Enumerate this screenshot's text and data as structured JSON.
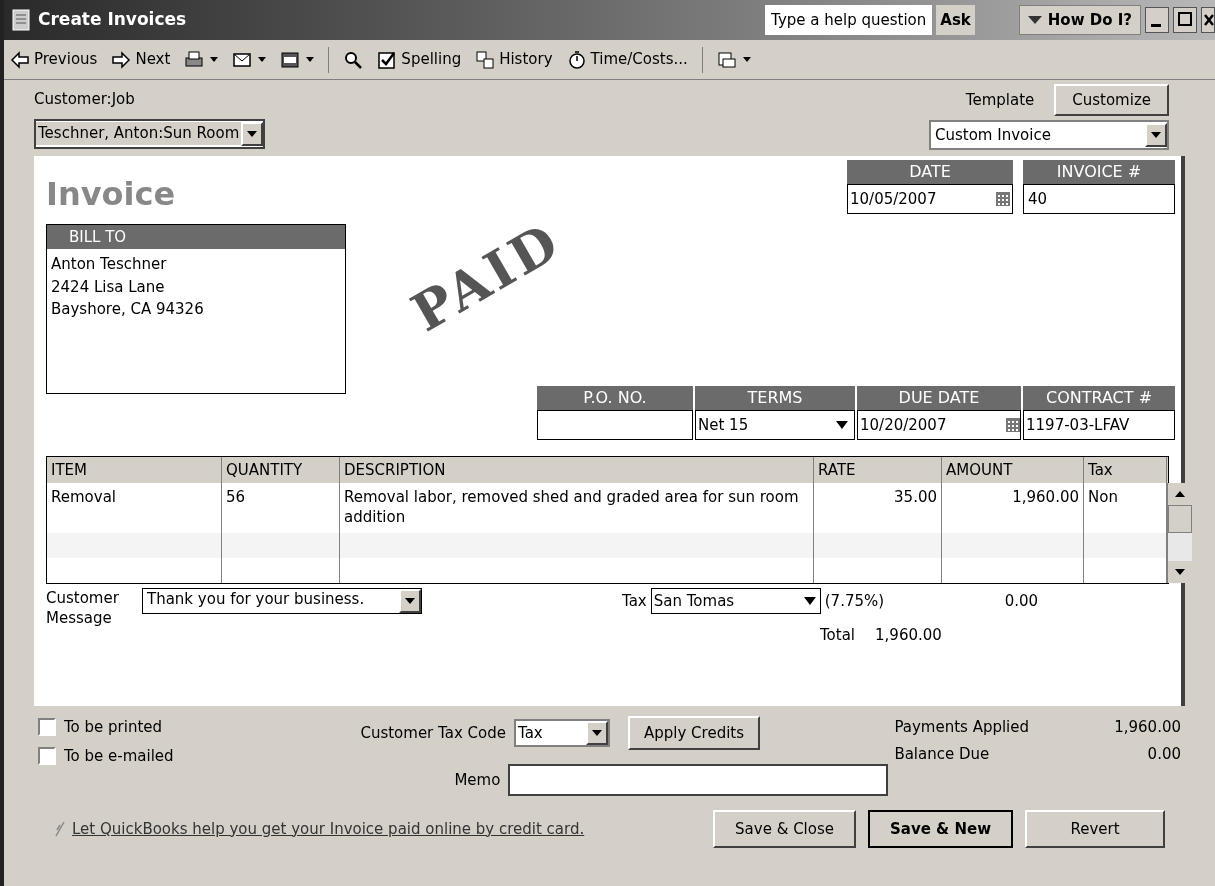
{
  "window": {
    "title": "Create Invoices"
  },
  "help": {
    "placeholder": "Type a help question",
    "ask": "Ask",
    "how_do_i": "How Do I?"
  },
  "toolbar": [
    {
      "kind": "previous",
      "label": "Previous"
    },
    {
      "kind": "next",
      "label": "Next"
    },
    {
      "kind": "print"
    },
    {
      "kind": "email"
    },
    {
      "kind": "form"
    },
    {
      "kind": "find"
    },
    {
      "kind": "spelling",
      "label": "Spelling"
    },
    {
      "kind": "history",
      "label": "History"
    },
    {
      "kind": "time",
      "label": "Time/Costs..."
    },
    {
      "kind": "letter"
    }
  ],
  "customer_job": {
    "label": "Customer:Job",
    "value": "Teschner, Anton:Sun Room"
  },
  "template": {
    "label": "Template",
    "value": "Custom Invoice",
    "customize": "Customize"
  },
  "invoice": {
    "heading": "Invoice",
    "stamp": "PAID",
    "date_label": "DATE",
    "date": "10/05/2007",
    "number_label": "INVOICE #",
    "number": "40",
    "bill_to_label": "BILL TO",
    "bill_to": [
      "Anton Teschner",
      "2424 Lisa Lane",
      "Bayshore, CA 94326"
    ]
  },
  "fields": [
    {
      "kind": "text",
      "label": "P.O. NO."
    },
    {
      "kind": "dropdown",
      "label": "TERMS",
      "value": "Net 15"
    },
    {
      "kind": "date",
      "label": "DUE DATE",
      "value": "10/20/2007"
    },
    {
      "kind": "text",
      "label": "CONTRACT #",
      "value": "1197-03-LFAV"
    }
  ],
  "table": {
    "columns": [
      "ITEM",
      "QUANTITY",
      "DESCRIPTION",
      "RATE",
      "AMOUNT",
      "Tax"
    ],
    "rows": [
      [
        "Removal",
        "56",
        "Removal labor, removed shed and graded area for sun room addition",
        "35.00",
        "1,960.00",
        "Non"
      ]
    ]
  },
  "message": {
    "label_1": "Customer",
    "label_2": "Message",
    "value": "Thank you for your business."
  },
  "tax": {
    "label": "Tax",
    "value": "San Tomas",
    "rate": "(7.75%)",
    "amount": "0.00"
  },
  "total": {
    "label": "Total",
    "value": "1,960.00"
  },
  "checkboxes": [
    {
      "label": "To be printed",
      "checked": false
    },
    {
      "label": "To be e-mailed",
      "checked": false
    }
  ],
  "tax_code": {
    "label": "Customer Tax Code",
    "value": "Tax"
  },
  "apply_credits": "Apply Credits",
  "summary": [
    {
      "label": "Payments Applied",
      "value": "1,960.00"
    },
    {
      "label": "Balance Due",
      "value": "0.00"
    }
  ],
  "memo": {
    "label": "Memo"
  },
  "link": "Let QuickBooks help you get your Invoice paid online by credit card.",
  "buttons": [
    {
      "label": "Save & Close",
      "primary": false
    },
    {
      "label": "Save & New",
      "primary": true
    },
    {
      "label": "Revert",
      "primary": false
    }
  ]
}
